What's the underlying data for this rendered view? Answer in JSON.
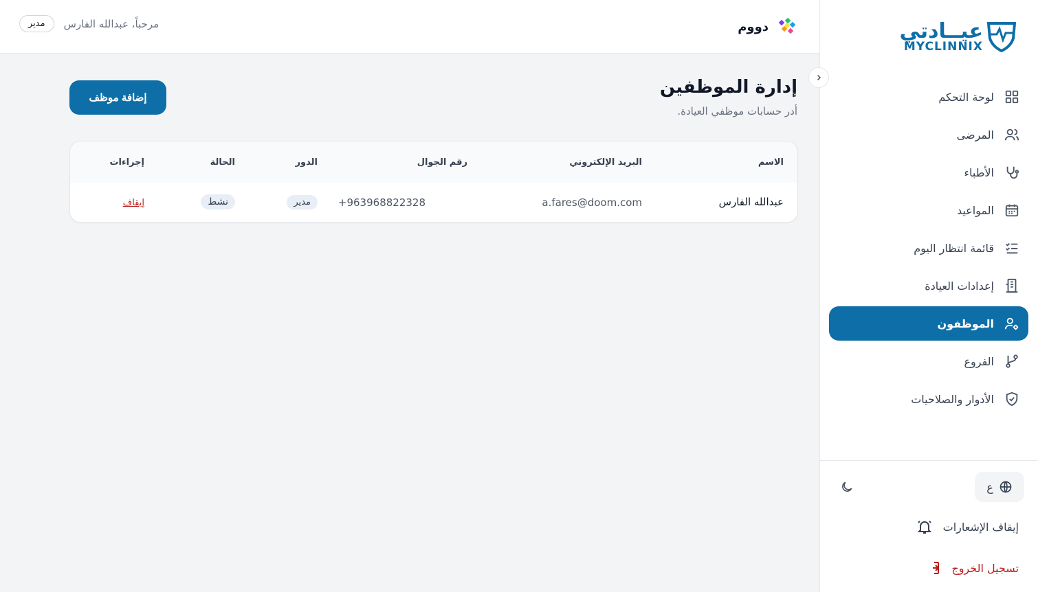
{
  "brand": {
    "name_ar": "عيــادتي",
    "name_en": "MYCLINNIX"
  },
  "header": {
    "clinic_name": "دووم",
    "welcome": "مرحباً، عبدالله الفارس",
    "role": "مدير"
  },
  "sidebar": {
    "items": [
      {
        "label": "لوحة التحكم",
        "icon": "grid-icon"
      },
      {
        "label": "المرضى",
        "icon": "users-icon"
      },
      {
        "label": "الأطباء",
        "icon": "stethoscope-icon"
      },
      {
        "label": "المواعيد",
        "icon": "calendar-icon"
      },
      {
        "label": "قائمة انتظار اليوم",
        "icon": "list-check-icon"
      },
      {
        "label": "إعدادات العيادة",
        "icon": "building-icon"
      },
      {
        "label": "الموظفون",
        "icon": "user-gear-icon",
        "active": true
      },
      {
        "label": "الفروع",
        "icon": "git-branch-icon"
      },
      {
        "label": "الأدوار والصلاحيات",
        "icon": "shield-check-icon"
      }
    ],
    "language_label": "ع",
    "mute_notifications": "إيقاف الإشعارات",
    "logout": "تسجيل الخروج"
  },
  "page": {
    "title": "إدارة الموظفين",
    "subtitle": "أدر حسابات موظفي العيادة.",
    "add_button": "إضافة موظف"
  },
  "table": {
    "columns": {
      "name": "الاسم",
      "email": "البريد الإلكتروني",
      "phone": "رقم الجوال",
      "role": "الدور",
      "status": "الحالة",
      "actions": "إجراءات"
    },
    "rows": [
      {
        "name": "عبدالله الفارس",
        "email": "a.fares@doom.com",
        "phone": "+963968822328",
        "role": "مدير",
        "status": "نشط",
        "action": "إيقاف"
      }
    ]
  },
  "colors": {
    "primary": "#0e6fa8",
    "danger": "#b91c1c",
    "background": "#f3f4f6"
  }
}
